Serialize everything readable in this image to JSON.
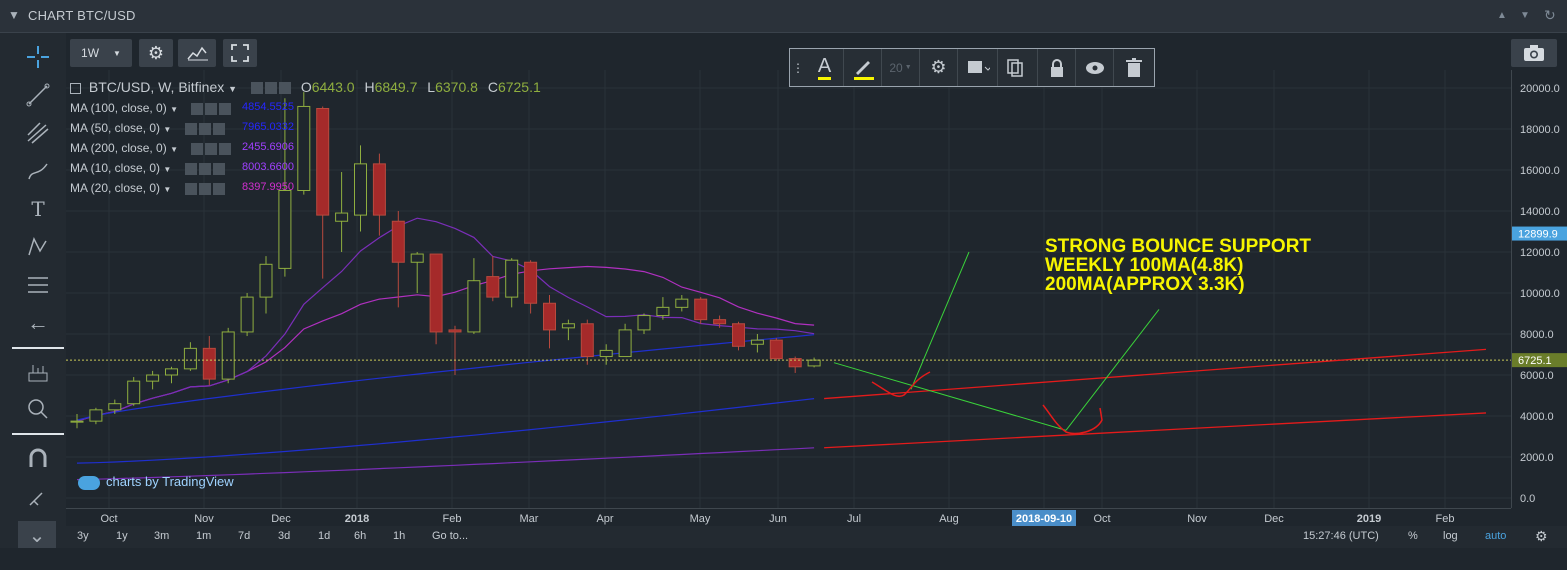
{
  "window": {
    "title": "CHART BTC/USD"
  },
  "toolbar": {
    "interval": "1W"
  },
  "drawing_toolbar": {
    "font_size": "20"
  },
  "symbol": {
    "name": "BTC/USD, W, Bitfinex",
    "o_label": "O",
    "o": "6443.0",
    "h_label": "H",
    "h": "6849.7",
    "l_label": "L",
    "l": "6370.8",
    "c_label": "C",
    "c": "6725.1"
  },
  "indicators": [
    {
      "label": "MA (100, close, 0)",
      "value": "4854.5525",
      "color": "#2222ff"
    },
    {
      "label": "MA (50, close, 0)",
      "value": "7965.0332",
      "color": "#2222ff"
    },
    {
      "label": "MA (200, close, 0)",
      "value": "2455.6906",
      "color": "#9b30ff"
    },
    {
      "label": "MA (10, close, 0)",
      "value": "8003.6600",
      "color": "#9b30ff"
    },
    {
      "label": "MA (20, close, 0)",
      "value": "8397.9950",
      "color": "#d020d0"
    }
  ],
  "annotation": {
    "line1": "STRONG BOUNCE SUPPORT",
    "line2": "WEEKLY 100MA(4.8K)",
    "line3": "200MA(APPROX 3.3K)",
    "color": "#f7f500"
  },
  "price_axis": {
    "ticks": [
      "20000.0",
      "18000.0",
      "16000.0",
      "14000.0",
      "12000.0",
      "10000.0",
      "8000.0",
      "6000.0",
      "4000.0",
      "2000.0",
      "0.0"
    ],
    "badge_high": "12899.9",
    "badge_last": "6725.1"
  },
  "time_axis": {
    "labels": [
      "Oct",
      "Nov",
      "Dec",
      "2018",
      "Feb",
      "Mar",
      "Apr",
      "May",
      "Jun",
      "Jul",
      "Aug",
      "2018-09-10",
      "Oct",
      "Nov",
      "Dec",
      "2019",
      "Feb"
    ]
  },
  "bottom_bar": {
    "ranges": [
      "3y",
      "1y",
      "3m",
      "1m",
      "7d",
      "3d",
      "1d",
      "6h",
      "1h",
      "Go to..."
    ],
    "time": "15:27:46 (UTC)",
    "percent": "%",
    "log": "log",
    "auto": "auto"
  },
  "watermark": "charts by TradingView",
  "colors": {
    "up": "#6b8e23",
    "down": "#a52a2a",
    "ma_blue": "#1f2fcf",
    "ma_purple": "#7a2eb8",
    "ma_magenta": "#b030c0",
    "support_line": "#e41b1b",
    "green_line": "#3ad33a",
    "last_line": "#c9c95a"
  },
  "chart_data": {
    "type": "candlestick",
    "title": "BTC/USD, W, Bitfinex",
    "ylim": [
      0,
      21000
    ],
    "x_dates_weekly_start": "2017-09-18",
    "candles": [
      {
        "o": 3700,
        "h": 4100,
        "l": 3400,
        "c": 3750
      },
      {
        "o": 3750,
        "h": 4400,
        "l": 3600,
        "c": 4300
      },
      {
        "o": 4300,
        "h": 4800,
        "l": 4100,
        "c": 4600
      },
      {
        "o": 4600,
        "h": 5900,
        "l": 4500,
        "c": 5700
      },
      {
        "o": 5700,
        "h": 6200,
        "l": 5300,
        "c": 6000
      },
      {
        "o": 6000,
        "h": 6400,
        "l": 5600,
        "c": 6300
      },
      {
        "o": 6300,
        "h": 7600,
        "l": 6200,
        "c": 7300
      },
      {
        "o": 7300,
        "h": 7900,
        "l": 5500,
        "c": 5800
      },
      {
        "o": 5800,
        "h": 8300,
        "l": 5600,
        "c": 8100
      },
      {
        "o": 8100,
        "h": 10000,
        "l": 7900,
        "c": 9800
      },
      {
        "o": 9800,
        "h": 11800,
        "l": 9000,
        "c": 11400
      },
      {
        "o": 11200,
        "h": 19500,
        "l": 10800,
        "c": 15000
      },
      {
        "o": 15000,
        "h": 19800,
        "l": 14800,
        "c": 19100
      },
      {
        "o": 19000,
        "h": 19100,
        "l": 10700,
        "c": 13800
      },
      {
        "o": 13500,
        "h": 15900,
        "l": 12000,
        "c": 13900
      },
      {
        "o": 13800,
        "h": 17200,
        "l": 13000,
        "c": 16300
      },
      {
        "o": 16300,
        "h": 16800,
        "l": 12800,
        "c": 13800
      },
      {
        "o": 13500,
        "h": 14000,
        "l": 9300,
        "c": 11500
      },
      {
        "o": 11500,
        "h": 12000,
        "l": 10000,
        "c": 11900
      },
      {
        "o": 11900,
        "h": 11900,
        "l": 7500,
        "c": 8100
      },
      {
        "o": 8200,
        "h": 8400,
        "l": 6000,
        "c": 8100
      },
      {
        "o": 8100,
        "h": 11700,
        "l": 8000,
        "c": 10600
      },
      {
        "o": 10800,
        "h": 11800,
        "l": 9600,
        "c": 9800
      },
      {
        "o": 9800,
        "h": 11700,
        "l": 9300,
        "c": 11600
      },
      {
        "o": 11500,
        "h": 11600,
        "l": 9000,
        "c": 9500
      },
      {
        "o": 9500,
        "h": 9900,
        "l": 7300,
        "c": 8200
      },
      {
        "o": 8300,
        "h": 8700,
        "l": 7700,
        "c": 8500
      },
      {
        "o": 8500,
        "h": 8700,
        "l": 6500,
        "c": 6900
      },
      {
        "o": 6900,
        "h": 7500,
        "l": 6500,
        "c": 7200
      },
      {
        "o": 6900,
        "h": 8500,
        "l": 6900,
        "c": 8200
      },
      {
        "o": 8200,
        "h": 9000,
        "l": 8000,
        "c": 8900
      },
      {
        "o": 8900,
        "h": 9800,
        "l": 8700,
        "c": 9300
      },
      {
        "o": 9300,
        "h": 9900,
        "l": 9100,
        "c": 9700
      },
      {
        "o": 9700,
        "h": 9800,
        "l": 8500,
        "c": 8700
      },
      {
        "o": 8700,
        "h": 8900,
        "l": 8300,
        "c": 8500
      },
      {
        "o": 8500,
        "h": 8600,
        "l": 7200,
        "c": 7400
      },
      {
        "o": 7500,
        "h": 8000,
        "l": 7100,
        "c": 7700
      },
      {
        "o": 7700,
        "h": 7800,
        "l": 6700,
        "c": 6800
      },
      {
        "o": 6800,
        "h": 6900,
        "l": 6100,
        "c": 6400
      },
      {
        "o": 6443,
        "h": 6850,
        "l": 6371,
        "c": 6725
      }
    ]
  }
}
